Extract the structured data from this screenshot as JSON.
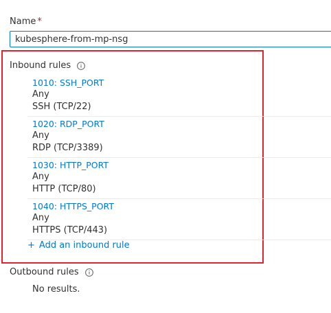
{
  "form": {
    "name_label": "Name",
    "required_marker": "*",
    "name_value": "kubesphere-from-mp-nsg"
  },
  "inbound": {
    "title": "Inbound rules",
    "rules": [
      {
        "name": "1010: SSH_PORT",
        "source": "Any",
        "service": "SSH (TCP/22)"
      },
      {
        "name": "1020: RDP_PORT",
        "source": "Any",
        "service": "RDP (TCP/3389)"
      },
      {
        "name": "1030: HTTP_PORT",
        "source": "Any",
        "service": "HTTP (TCP/80)"
      },
      {
        "name": "1040: HTTPS_PORT",
        "source": "Any",
        "service": "HTTPS (TCP/443)"
      }
    ],
    "add_label": "Add an inbound rule",
    "add_icon": "+"
  },
  "outbound": {
    "title": "Outbound rules",
    "empty_text": "No results."
  },
  "colors": {
    "link": "#0078d4",
    "highlight": "#e3212c",
    "required": "#a4262c"
  }
}
